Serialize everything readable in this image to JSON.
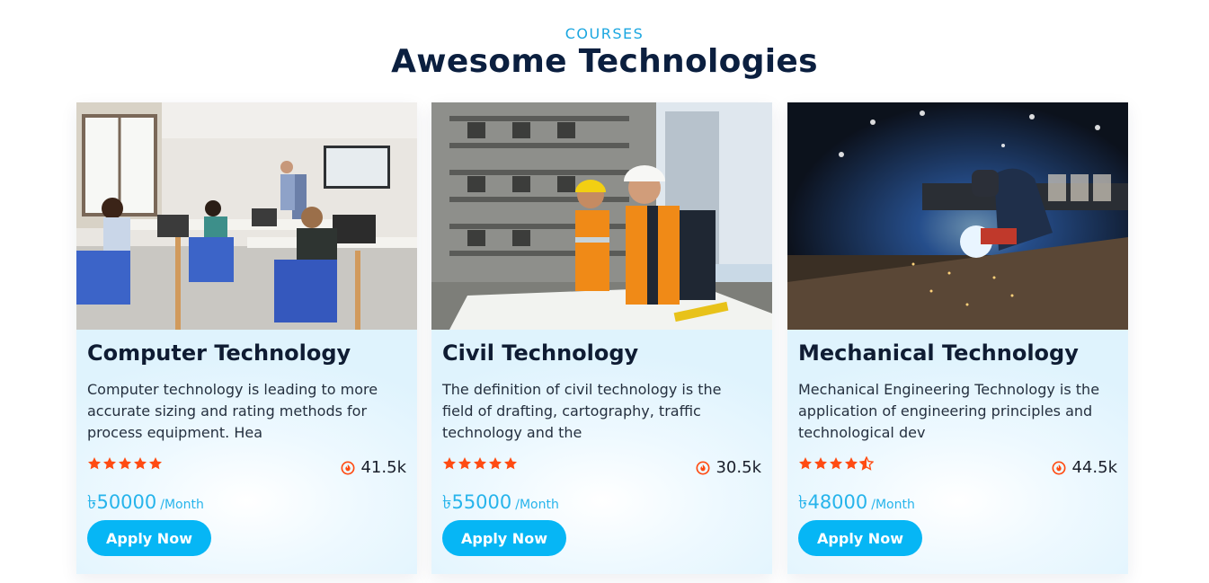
{
  "header": {
    "eyebrow": "COURSES",
    "title": "Awesome Technologies"
  },
  "colors": {
    "accent": "#06b6f5",
    "eyebrow": "#1aa6e0",
    "price": "#27b4eb",
    "star": "#ff4b12",
    "heading": "#0b1f3f"
  },
  "courses": [
    {
      "title": "Computer Technology",
      "description": "Computer technology is leading to more accurate sizing and rating methods for process equipment. Hea",
      "rating": 5,
      "views": "41.5k",
      "views_icon": "fire-icon",
      "price": "৳50000",
      "period": "/Month",
      "button": "Apply Now",
      "image": "classroom-photo"
    },
    {
      "title": "Civil Technology",
      "description": "The definition of civil technology is the field of drafting, cartography, traffic technology and the",
      "rating": 5,
      "views": "30.5k",
      "views_icon": "fire-icon",
      "price": "৳55000",
      "period": "/Month",
      "button": "Apply Now",
      "image": "construction-photo"
    },
    {
      "title": "Mechanical Technology",
      "description": "Mechanical Engineering Technology is the application of engineering principles and technological dev",
      "rating": 4.5,
      "views": "44.5k",
      "views_icon": "fire-icon",
      "price": "৳48000",
      "period": "/Month",
      "button": "Apply Now",
      "image": "welding-photo"
    }
  ]
}
